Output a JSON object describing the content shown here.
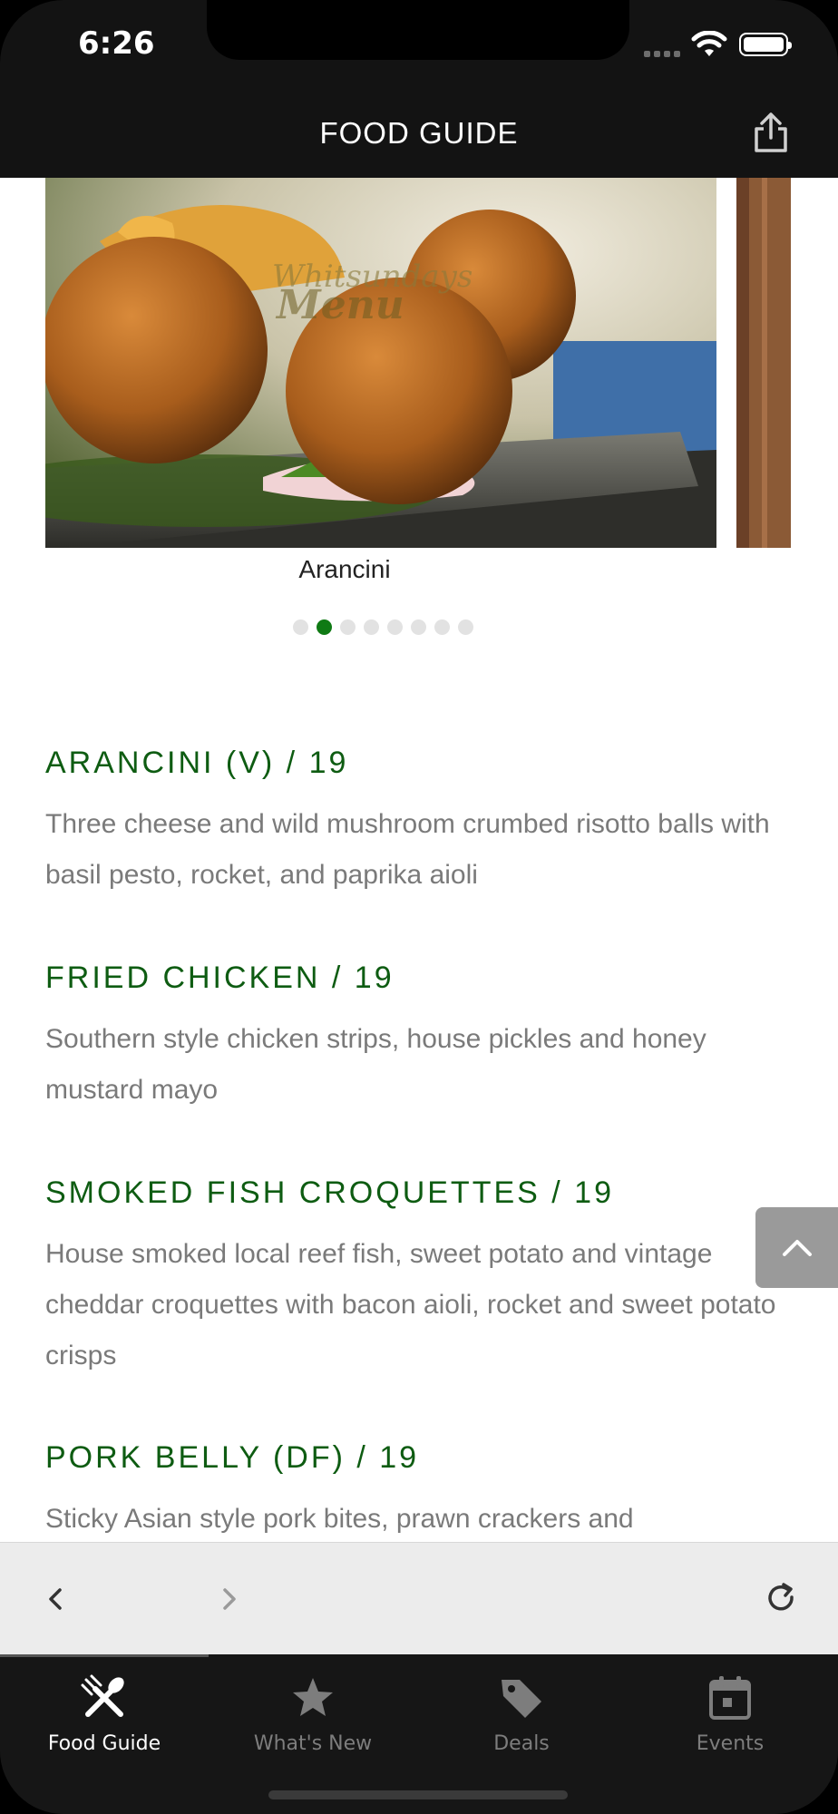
{
  "status_bar": {
    "time": "6:26"
  },
  "header": {
    "title": "FOOD GUIDE"
  },
  "carousel": {
    "caption": "Arancini",
    "dot_count": 8,
    "active_index": 1,
    "image_watermark": "Whitsundays Menu"
  },
  "menu_items": [
    {
      "title": "ARANCINI (V) / 19",
      "description": "Three cheese and wild mushroom crumbed risotto balls with basil pesto, rocket, and paprika aioli"
    },
    {
      "title": "FRIED CHICKEN / 19",
      "description": "Southern style chicken strips, house pickles and honey mustard mayo"
    },
    {
      "title": "SMOKED FISH CROQUETTES / 19",
      "description": "House smoked local reef fish, sweet potato and vintage cheddar croquettes with bacon aioli, rocket and sweet potato crisps"
    },
    {
      "title": "PORK BELLY (DF) / 19",
      "description": "Sticky Asian style pork bites, prawn crackers and"
    }
  ],
  "tabs": [
    {
      "label": "Food Guide",
      "icon": "utensils-icon",
      "active": true
    },
    {
      "label": "What's New",
      "icon": "star-icon",
      "active": false
    },
    {
      "label": "Deals",
      "icon": "tag-icon",
      "active": false
    },
    {
      "label": "Events",
      "icon": "calendar-icon",
      "active": false
    }
  ],
  "colors": {
    "accent": "#0e5c12",
    "active_dot": "#0f7a14",
    "tabbar": "#161616"
  }
}
